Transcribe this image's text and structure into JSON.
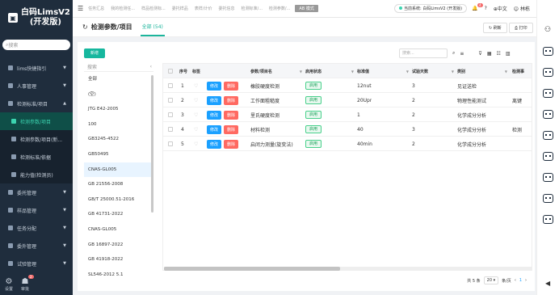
{
  "app": {
    "title": "白码LimsV2",
    "subtitle": "(开发版)"
  },
  "sidebar": {
    "search_placeholder": "搜索",
    "menus": [
      {
        "label": "lims快捷指引"
      },
      {
        "label": "人事管理"
      },
      {
        "label": "检测标准/项目"
      }
    ],
    "submenus": [
      {
        "label": "检测参数/项目",
        "active": true
      },
      {
        "label": "检测参数/项目(新..."
      },
      {
        "label": "检测标准/依据"
      },
      {
        "label": "能力值(检测员)"
      }
    ],
    "menus2": [
      {
        "label": "委托管理"
      },
      {
        "label": "样品管理"
      },
      {
        "label": "任务分配"
      },
      {
        "label": "委外管理"
      },
      {
        "label": "试验管理"
      }
    ],
    "footer": {
      "settings": "设置",
      "review": "审批",
      "review_count": "2"
    }
  },
  "topbar": {
    "tabs": [
      "任务汇总",
      "我的检测任...",
      "样品检测标...",
      "委托样品",
      "表样/计价",
      "委托信息",
      "检测标准/...",
      "检测参数/..."
    ],
    "current_tab": "AB 模式",
    "system": "当前系统: 白码LimsV2 (开发版)",
    "bell_count": "4",
    "language": "中文",
    "user": "林栋"
  },
  "header": {
    "title": "检测参数/项目",
    "tab": "全部 (54)",
    "btn_refresh": "刷新",
    "btn_print": "打印"
  },
  "toolbar": {
    "add": "新增",
    "search_placeholder": "搜索..."
  },
  "category": {
    "search_placeholder": "搜索",
    "items": [
      "全部",
      "(空)",
      "JTG E42-2005",
      "100",
      "GB3245-4522",
      "GB50495",
      "CNAS-GL005",
      "GB 21556-2008",
      "GB/T 25000.51-2016",
      "GB 41731-2022",
      "CNAS-GL005",
      "GB 16897-2022",
      "GB 41918-2022",
      "SL546-2012 5.1"
    ],
    "selected_index": 6
  },
  "table": {
    "headers": {
      "seq": "序号",
      "tag": "标签",
      "param": "参数/项目名",
      "status": "启用状态",
      "std": "标准值",
      "days": "试验天数",
      "type": "类别",
      "method": "检测事"
    },
    "edit_label": "修改",
    "delete_label": "删除",
    "rows": [
      {
        "seq": "1",
        "param": "橡胶硬度检测",
        "status": "启用",
        "std": "12nut",
        "days": "3",
        "type": "见证送检",
        "method": ""
      },
      {
        "seq": "2",
        "param": "工作面粗糙度",
        "status": "启用",
        "std": "20Upr",
        "days": "2",
        "type": "物理性能测试",
        "method": "离键"
      },
      {
        "seq": "3",
        "param": "里氏硬度检测",
        "status": "启用",
        "std": "1",
        "days": "2",
        "type": "化学成分分析",
        "method": ""
      },
      {
        "seq": "4",
        "param": "材料检测",
        "status": "启用",
        "std": "40",
        "days": "3",
        "type": "化学成分分析",
        "method": "检测"
      },
      {
        "seq": "5",
        "param": "启闭力测量(旋变法)",
        "status": "启用",
        "std": "40min",
        "days": "2",
        "type": "化学成分分析",
        "method": ""
      }
    ]
  },
  "pagination": {
    "total": "共 5 条",
    "page_size": "20",
    "per_page": "条/页",
    "current": "1"
  }
}
